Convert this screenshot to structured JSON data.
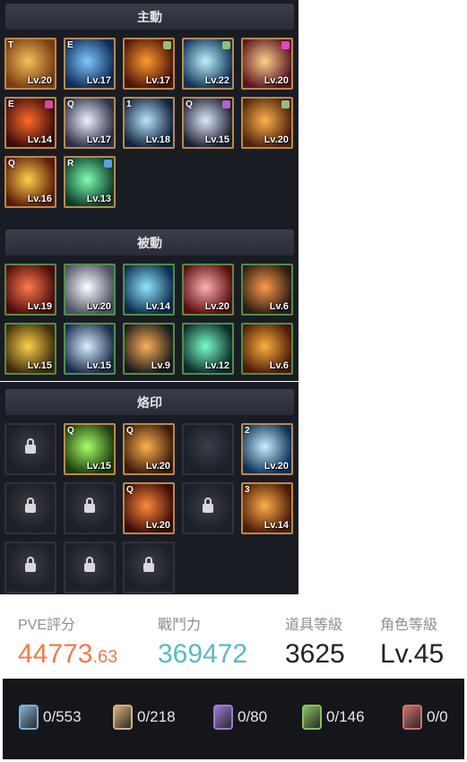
{
  "sections": {
    "active_title": "主動",
    "passive_title": "被動",
    "engraving_title": "烙印"
  },
  "active_skills": [
    {
      "key": "T",
      "level": "Lv.20",
      "colors": [
        "#f2c35a",
        "#7a3b12"
      ]
    },
    {
      "key": "E",
      "level": "Lv.17",
      "colors": [
        "#7fc8ff",
        "#0d2a57"
      ]
    },
    {
      "key": "",
      "level": "Lv.17",
      "colors": [
        "#ff9b2e",
        "#4a1208"
      ],
      "gem": "#8fc27a"
    },
    {
      "key": "",
      "level": "Lv.22",
      "colors": [
        "#bff2ff",
        "#0d3358"
      ],
      "gem": "#8fc27a"
    },
    {
      "key": "",
      "level": "Lv.20",
      "colors": [
        "#ffd08a",
        "#5a1420"
      ],
      "gem": "#e048c0"
    },
    {
      "key": "E",
      "level": "Lv.14",
      "colors": [
        "#ff6a2a",
        "#3a0b0b"
      ],
      "gem": "#d04aa0"
    },
    {
      "key": "Q",
      "level": "Lv.17",
      "colors": [
        "#eef2ff",
        "#2a2f45"
      ]
    },
    {
      "key": "1",
      "level": "Lv.18",
      "colors": [
        "#b8e4ff",
        "#11203a"
      ]
    },
    {
      "key": "Q",
      "level": "Lv.15",
      "colors": [
        "#dfe8ff",
        "#1b1e2e"
      ],
      "gem": "#b060d0"
    },
    {
      "key": "",
      "level": "Lv.20",
      "colors": [
        "#ffb24a",
        "#4a1f0b"
      ],
      "gem": "#8fc27a"
    },
    {
      "key": "Q",
      "level": "Lv.16",
      "colors": [
        "#ffd04a",
        "#5a1a08"
      ]
    },
    {
      "key": "R",
      "level": "Lv.13",
      "colors": [
        "#7fffb0",
        "#0b3a2a"
      ],
      "gem": "#5aa0e0"
    }
  ],
  "passive_skills": [
    {
      "level": "Lv.19",
      "colors": [
        "#ff7a4a",
        "#4a0b0b"
      ]
    },
    {
      "level": "Lv.20",
      "colors": [
        "#ffffff",
        "#4a5060"
      ]
    },
    {
      "level": "Lv.14",
      "colors": [
        "#8fe8ff",
        "#0b2a4a"
      ]
    },
    {
      "level": "Lv.20",
      "colors": [
        "#ffb0b0",
        "#5a0b0b"
      ]
    },
    {
      "level": "Lv.6",
      "colors": [
        "#ff9a4a",
        "#2a1a14"
      ]
    },
    {
      "level": "Lv.15",
      "colors": [
        "#ffd04a",
        "#3a2a0b"
      ]
    },
    {
      "level": "Lv.15",
      "colors": [
        "#d8f0ff",
        "#1a2a4a"
      ]
    },
    {
      "level": "Lv.9",
      "colors": [
        "#ffb05a",
        "#1a1a1a"
      ]
    },
    {
      "level": "Lv.12",
      "colors": [
        "#7affc8",
        "#0b2a2a"
      ]
    },
    {
      "level": "Lv.6",
      "colors": [
        "#ffb040",
        "#4a1a08"
      ]
    }
  ],
  "engravings": [
    {
      "locked": true
    },
    {
      "key": "Q",
      "level": "Lv.15",
      "colors": [
        "#a8ff6a",
        "#1a3a0b"
      ]
    },
    {
      "key": "Q",
      "level": "Lv.20",
      "colors": [
        "#ffb050",
        "#3a1a08"
      ]
    },
    {
      "locked": true,
      "empty": true
    },
    {
      "key": "2",
      "level": "Lv.20",
      "colors": [
        "#c8f0ff",
        "#0b3058"
      ]
    },
    {
      "locked": true
    },
    {
      "locked": true
    },
    {
      "key": "Q",
      "level": "Lv.20",
      "colors": [
        "#ff8a3a",
        "#3a0b08"
      ]
    },
    {
      "locked": true
    },
    {
      "key": "3",
      "level": "Lv.14",
      "colors": [
        "#ffb04a",
        "#4a1a08"
      ]
    },
    {
      "locked": true
    },
    {
      "locked": true
    },
    {
      "locked": true
    }
  ],
  "stats": {
    "pve_label": "PVE評分",
    "pve_main": "44773",
    "pve_decimal": ".63",
    "power_label": "戰鬥力",
    "power_value": "369472",
    "item_level_label": "道具等級",
    "item_level_value": "3625",
    "char_level_label": "角色等級",
    "char_level_value": "Lv.45"
  },
  "cards": [
    {
      "count": "0/553",
      "color": "#7fb0d0"
    },
    {
      "count": "0/218",
      "color": "#d8b07a"
    },
    {
      "count": "0/80",
      "color": "#a07ad0"
    },
    {
      "count": "0/146",
      "color": "#8ac060"
    },
    {
      "count": "0/0",
      "color": "#d0706a"
    }
  ],
  "colors": {
    "pve": "#f07a4a",
    "power": "#5ab8c8",
    "item_level": "#222222",
    "char_level": "#222222"
  }
}
